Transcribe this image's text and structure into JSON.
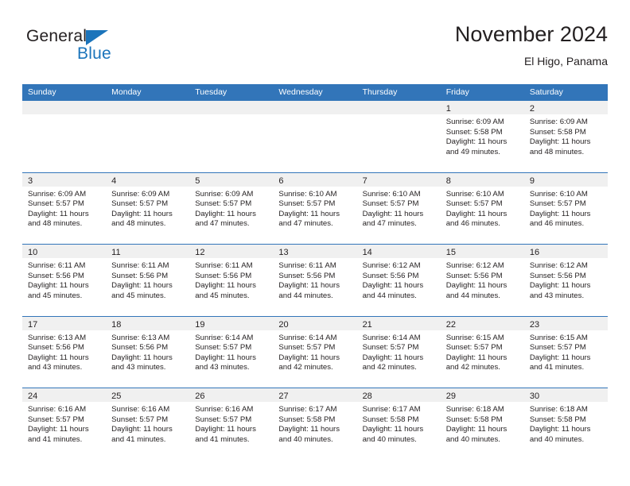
{
  "brand": {
    "name_part1": "General",
    "name_part2": "Blue",
    "triangle_color": "#1b74bb"
  },
  "header": {
    "title": "November 2024",
    "subtitle": "El Higo, Panama"
  },
  "theme": {
    "header_blue": "#3275b9",
    "day_head_gray": "#f0f0f0",
    "text": "#231f20"
  },
  "weekdays": [
    "Sunday",
    "Monday",
    "Tuesday",
    "Wednesday",
    "Thursday",
    "Friday",
    "Saturday"
  ],
  "weeks": [
    [
      {
        "day": "",
        "sunrise": "",
        "sunset": "",
        "daylight_1": "",
        "daylight_2": ""
      },
      {
        "day": "",
        "sunrise": "",
        "sunset": "",
        "daylight_1": "",
        "daylight_2": ""
      },
      {
        "day": "",
        "sunrise": "",
        "sunset": "",
        "daylight_1": "",
        "daylight_2": ""
      },
      {
        "day": "",
        "sunrise": "",
        "sunset": "",
        "daylight_1": "",
        "daylight_2": ""
      },
      {
        "day": "",
        "sunrise": "",
        "sunset": "",
        "daylight_1": "",
        "daylight_2": ""
      },
      {
        "day": "1",
        "sunrise": "Sunrise: 6:09 AM",
        "sunset": "Sunset: 5:58 PM",
        "daylight_1": "Daylight: 11 hours",
        "daylight_2": "and 49 minutes."
      },
      {
        "day": "2",
        "sunrise": "Sunrise: 6:09 AM",
        "sunset": "Sunset: 5:58 PM",
        "daylight_1": "Daylight: 11 hours",
        "daylight_2": "and 48 minutes."
      }
    ],
    [
      {
        "day": "3",
        "sunrise": "Sunrise: 6:09 AM",
        "sunset": "Sunset: 5:57 PM",
        "daylight_1": "Daylight: 11 hours",
        "daylight_2": "and 48 minutes."
      },
      {
        "day": "4",
        "sunrise": "Sunrise: 6:09 AM",
        "sunset": "Sunset: 5:57 PM",
        "daylight_1": "Daylight: 11 hours",
        "daylight_2": "and 48 minutes."
      },
      {
        "day": "5",
        "sunrise": "Sunrise: 6:09 AM",
        "sunset": "Sunset: 5:57 PM",
        "daylight_1": "Daylight: 11 hours",
        "daylight_2": "and 47 minutes."
      },
      {
        "day": "6",
        "sunrise": "Sunrise: 6:10 AM",
        "sunset": "Sunset: 5:57 PM",
        "daylight_1": "Daylight: 11 hours",
        "daylight_2": "and 47 minutes."
      },
      {
        "day": "7",
        "sunrise": "Sunrise: 6:10 AM",
        "sunset": "Sunset: 5:57 PM",
        "daylight_1": "Daylight: 11 hours",
        "daylight_2": "and 47 minutes."
      },
      {
        "day": "8",
        "sunrise": "Sunrise: 6:10 AM",
        "sunset": "Sunset: 5:57 PM",
        "daylight_1": "Daylight: 11 hours",
        "daylight_2": "and 46 minutes."
      },
      {
        "day": "9",
        "sunrise": "Sunrise: 6:10 AM",
        "sunset": "Sunset: 5:57 PM",
        "daylight_1": "Daylight: 11 hours",
        "daylight_2": "and 46 minutes."
      }
    ],
    [
      {
        "day": "10",
        "sunrise": "Sunrise: 6:11 AM",
        "sunset": "Sunset: 5:56 PM",
        "daylight_1": "Daylight: 11 hours",
        "daylight_2": "and 45 minutes."
      },
      {
        "day": "11",
        "sunrise": "Sunrise: 6:11 AM",
        "sunset": "Sunset: 5:56 PM",
        "daylight_1": "Daylight: 11 hours",
        "daylight_2": "and 45 minutes."
      },
      {
        "day": "12",
        "sunrise": "Sunrise: 6:11 AM",
        "sunset": "Sunset: 5:56 PM",
        "daylight_1": "Daylight: 11 hours",
        "daylight_2": "and 45 minutes."
      },
      {
        "day": "13",
        "sunrise": "Sunrise: 6:11 AM",
        "sunset": "Sunset: 5:56 PM",
        "daylight_1": "Daylight: 11 hours",
        "daylight_2": "and 44 minutes."
      },
      {
        "day": "14",
        "sunrise": "Sunrise: 6:12 AM",
        "sunset": "Sunset: 5:56 PM",
        "daylight_1": "Daylight: 11 hours",
        "daylight_2": "and 44 minutes."
      },
      {
        "day": "15",
        "sunrise": "Sunrise: 6:12 AM",
        "sunset": "Sunset: 5:56 PM",
        "daylight_1": "Daylight: 11 hours",
        "daylight_2": "and 44 minutes."
      },
      {
        "day": "16",
        "sunrise": "Sunrise: 6:12 AM",
        "sunset": "Sunset: 5:56 PM",
        "daylight_1": "Daylight: 11 hours",
        "daylight_2": "and 43 minutes."
      }
    ],
    [
      {
        "day": "17",
        "sunrise": "Sunrise: 6:13 AM",
        "sunset": "Sunset: 5:56 PM",
        "daylight_1": "Daylight: 11 hours",
        "daylight_2": "and 43 minutes."
      },
      {
        "day": "18",
        "sunrise": "Sunrise: 6:13 AM",
        "sunset": "Sunset: 5:56 PM",
        "daylight_1": "Daylight: 11 hours",
        "daylight_2": "and 43 minutes."
      },
      {
        "day": "19",
        "sunrise": "Sunrise: 6:14 AM",
        "sunset": "Sunset: 5:57 PM",
        "daylight_1": "Daylight: 11 hours",
        "daylight_2": "and 43 minutes."
      },
      {
        "day": "20",
        "sunrise": "Sunrise: 6:14 AM",
        "sunset": "Sunset: 5:57 PM",
        "daylight_1": "Daylight: 11 hours",
        "daylight_2": "and 42 minutes."
      },
      {
        "day": "21",
        "sunrise": "Sunrise: 6:14 AM",
        "sunset": "Sunset: 5:57 PM",
        "daylight_1": "Daylight: 11 hours",
        "daylight_2": "and 42 minutes."
      },
      {
        "day": "22",
        "sunrise": "Sunrise: 6:15 AM",
        "sunset": "Sunset: 5:57 PM",
        "daylight_1": "Daylight: 11 hours",
        "daylight_2": "and 42 minutes."
      },
      {
        "day": "23",
        "sunrise": "Sunrise: 6:15 AM",
        "sunset": "Sunset: 5:57 PM",
        "daylight_1": "Daylight: 11 hours",
        "daylight_2": "and 41 minutes."
      }
    ],
    [
      {
        "day": "24",
        "sunrise": "Sunrise: 6:16 AM",
        "sunset": "Sunset: 5:57 PM",
        "daylight_1": "Daylight: 11 hours",
        "daylight_2": "and 41 minutes."
      },
      {
        "day": "25",
        "sunrise": "Sunrise: 6:16 AM",
        "sunset": "Sunset: 5:57 PM",
        "daylight_1": "Daylight: 11 hours",
        "daylight_2": "and 41 minutes."
      },
      {
        "day": "26",
        "sunrise": "Sunrise: 6:16 AM",
        "sunset": "Sunset: 5:57 PM",
        "daylight_1": "Daylight: 11 hours",
        "daylight_2": "and 41 minutes."
      },
      {
        "day": "27",
        "sunrise": "Sunrise: 6:17 AM",
        "sunset": "Sunset: 5:58 PM",
        "daylight_1": "Daylight: 11 hours",
        "daylight_2": "and 40 minutes."
      },
      {
        "day": "28",
        "sunrise": "Sunrise: 6:17 AM",
        "sunset": "Sunset: 5:58 PM",
        "daylight_1": "Daylight: 11 hours",
        "daylight_2": "and 40 minutes."
      },
      {
        "day": "29",
        "sunrise": "Sunrise: 6:18 AM",
        "sunset": "Sunset: 5:58 PM",
        "daylight_1": "Daylight: 11 hours",
        "daylight_2": "and 40 minutes."
      },
      {
        "day": "30",
        "sunrise": "Sunrise: 6:18 AM",
        "sunset": "Sunset: 5:58 PM",
        "daylight_1": "Daylight: 11 hours",
        "daylight_2": "and 40 minutes."
      }
    ]
  ]
}
